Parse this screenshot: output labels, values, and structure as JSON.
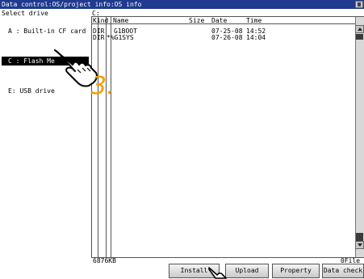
{
  "window": {
    "title": "Data control:OS/project info:OS info"
  },
  "drive_panel": {
    "label": "Select drive",
    "drives": [
      {
        "label": "A : Built-in CF card",
        "selected": false
      },
      {
        "label": "C : Flash Me",
        "selected": true
      },
      {
        "label": "E: USB drive",
        "selected": false
      }
    ]
  },
  "file_list": {
    "path": "C:",
    "columns": {
      "kind": "Kind",
      "name": "Name",
      "size": "Size",
      "date": "Date",
      "time": "Time"
    },
    "rows": [
      {
        "kind": "DIR",
        "name": "G1BOOT",
        "size": "",
        "date": "07-25-08",
        "time": "14:52"
      },
      {
        "kind": "DIR",
        "name": "*%G1SYS",
        "size": "",
        "date": "07-26-08",
        "time": "14:04"
      }
    ],
    "free_size": "6876KB",
    "file_count": "0File"
  },
  "buttons": {
    "install": "Install",
    "upload": "Upload",
    "property": "Property",
    "data_check": "Data check"
  },
  "annotation": {
    "step": "3."
  },
  "colors": {
    "title_bar": "#1f3a8f",
    "selected_drive": "#000000",
    "step_label": "#f5a100"
  }
}
